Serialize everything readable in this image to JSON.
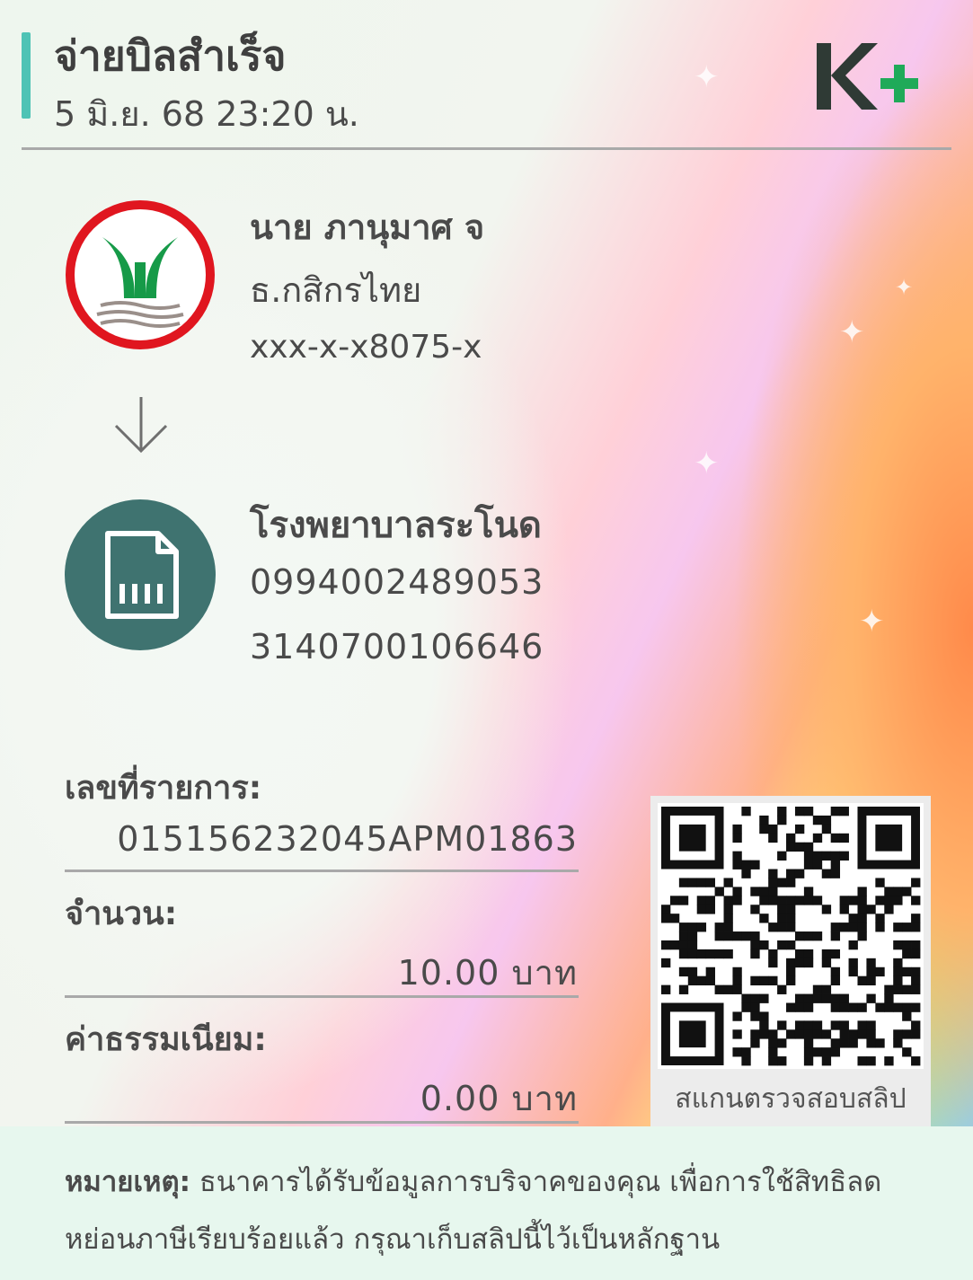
{
  "header": {
    "title": "จ่ายบิลสำเร็จ",
    "datetime": "5 มิ.ย. 68  23:20 น.",
    "brand_logo": "K+",
    "accent_color": "#4fc3b5"
  },
  "sender": {
    "name": "นาย ภานุมาศ จ",
    "bank": "ธ.กสิกรไทย",
    "account": "xxx-x-x8075-x",
    "logo_icon": "kbank-logo"
  },
  "transfer_arrow_icon": "arrow-down-icon",
  "receiver": {
    "name": "โรงพยาบาลระโนด",
    "ref1": "0994002489053",
    "ref2": "3140700106646",
    "logo_icon": "bill-document-icon",
    "logo_color": "#3f7370"
  },
  "details": {
    "transaction_label": "เลขที่รายการ:",
    "transaction_value": "015156232045APM01863",
    "amount_label": "จำนวน:",
    "amount_value": "10.00 บาท",
    "fee_label": "ค่าธรรมเนียม:",
    "fee_value": "0.00 บาท"
  },
  "qr": {
    "caption": "สแกนตรวจสอบสลิป"
  },
  "note": {
    "label": "หมายเหตุ:",
    "text": " ธนาคารได้รับข้อมูลการบริจาคของคุณ เพื่อการใช้สิทธิลดหย่อนภาษีเรียบร้อยแล้ว กรุณาเก็บสลิปนี้ไว้เป็นหลักฐาน"
  }
}
